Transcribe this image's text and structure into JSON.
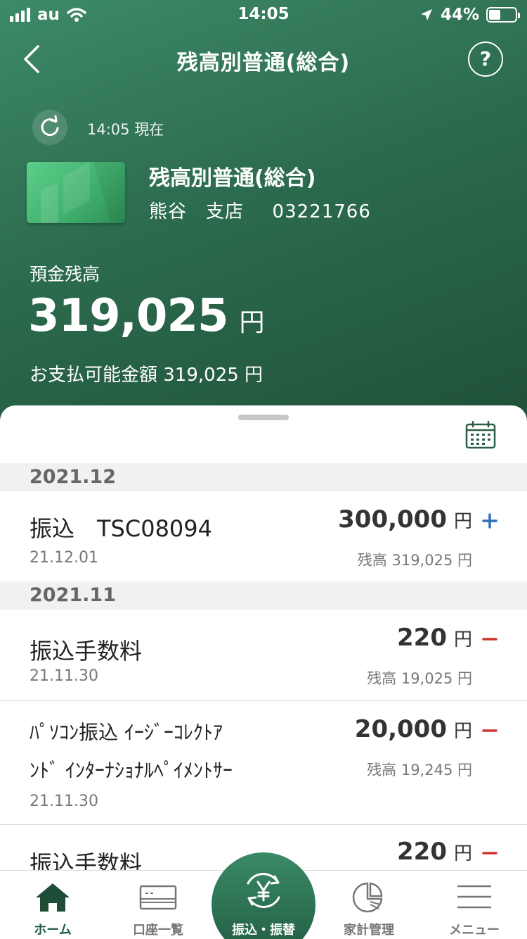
{
  "status_bar": {
    "carrier": "au",
    "time": "14:05",
    "battery_percent": "44%",
    "battery_level": 0.44
  },
  "nav": {
    "title": "残高別普通(総合)",
    "help_label": "?"
  },
  "refresh": {
    "as_of": "14:05 現在"
  },
  "account": {
    "name": "残高別普通(総合)",
    "branch": "熊谷　支店",
    "number": "03221766"
  },
  "balance": {
    "label": "預金残高",
    "amount": "319,025",
    "unit": "円",
    "available_text": "お支払可能金額 319,025 円"
  },
  "transactions": {
    "sections": [
      {
        "month": "2021.12",
        "items": [
          {
            "title": "振込　TSC08094",
            "date": "21.12.01",
            "amount": "300,000",
            "unit": "円",
            "type": "deposit",
            "balance": "残高 319,025 円"
          }
        ]
      },
      {
        "month": "2021.11",
        "items": [
          {
            "title": "振込手数料",
            "date": "21.11.30",
            "amount": "220",
            "unit": "円",
            "type": "withdrawal",
            "balance": "残高 19,025 円"
          },
          {
            "title_line1": "ﾊﾟｿｺﾝ振込 ｲｰｼﾞｰｺﾚｸﾄｱ",
            "title_line2": "ﾝﾄﾞ ｲﾝﾀｰﾅｼｮﾅﾙﾍﾟｲﾒﾝﾄｻｰ",
            "date": "21.11.30",
            "amount": "20,000",
            "unit": "円",
            "type": "withdrawal",
            "balance": "残高 19,245 円"
          },
          {
            "title": "振込手数料",
            "amount": "220",
            "unit": "円",
            "type": "withdrawal"
          }
        ]
      }
    ]
  },
  "tabbar": {
    "home": "ホーム",
    "accounts": "口座一覧",
    "transfer": "振込・振替",
    "household": "家計管理",
    "menu": "メニュー"
  },
  "colors": {
    "header_green": "#2c6b4e",
    "deposit_blue": "#2f6fb8",
    "withdraw_red": "#d0352e"
  }
}
